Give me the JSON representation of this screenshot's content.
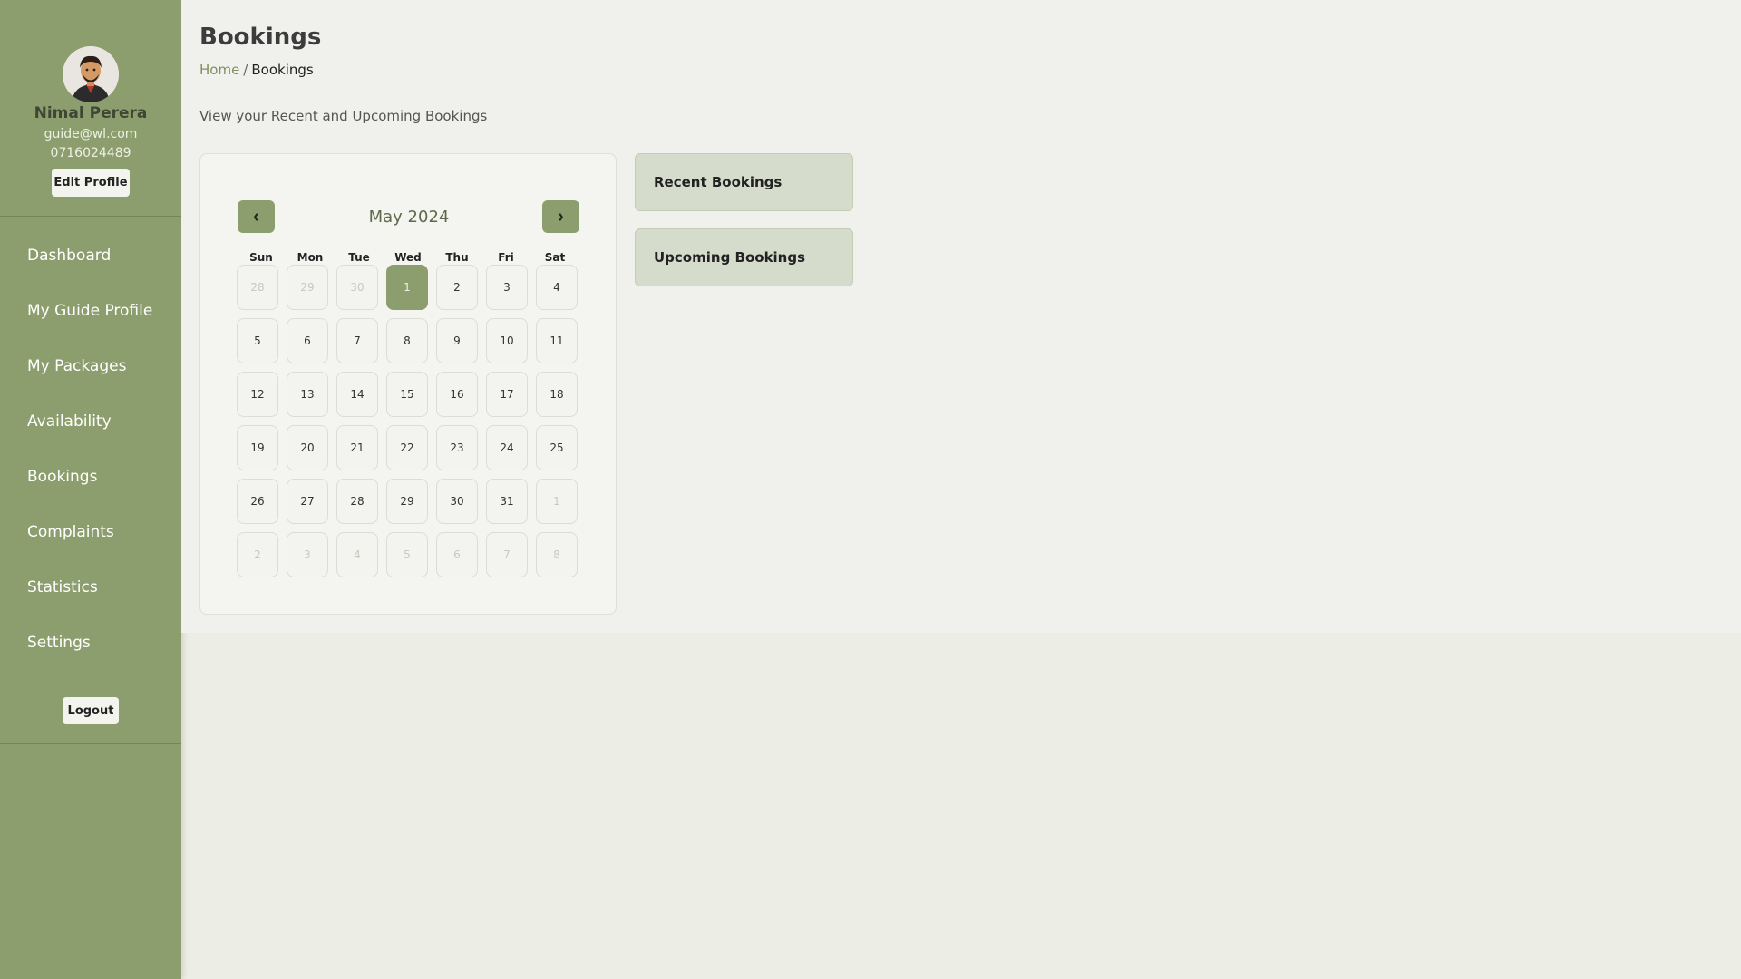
{
  "sidebar": {
    "profile": {
      "name": "Nimal Perera",
      "email": "guide@wl.com",
      "phone": "0716024489",
      "edit_label": "Edit Profile"
    },
    "items": [
      {
        "label": "Dashboard"
      },
      {
        "label": "My Guide Profile"
      },
      {
        "label": "My Packages"
      },
      {
        "label": "Availability"
      },
      {
        "label": "Bookings"
      },
      {
        "label": "Complaints"
      },
      {
        "label": "Statistics"
      },
      {
        "label": "Settings"
      }
    ],
    "logout_label": "Logout"
  },
  "header": {
    "title": "Bookings",
    "breadcrumb": {
      "home": "Home",
      "separator": "/",
      "current": "Bookings"
    },
    "subtitle": "View your Recent and Upcoming Bookings"
  },
  "calendar": {
    "month_label": "May 2024",
    "prev_icon": "‹",
    "next_icon": "›",
    "weekdays": [
      "Sun",
      "Mon",
      "Tue",
      "Wed",
      "Thu",
      "Fri",
      "Sat"
    ],
    "days": [
      "28",
      "29",
      "30",
      "1",
      "2",
      "3",
      "4",
      "5",
      "6",
      "7",
      "8",
      "9",
      "10",
      "11",
      "12",
      "13",
      "14",
      "15",
      "16",
      "17",
      "18",
      "19",
      "20",
      "21",
      "22",
      "23",
      "24",
      "25",
      "26",
      "27",
      "28",
      "29",
      "30",
      "31",
      "1",
      "2",
      "3",
      "4",
      "5",
      "6",
      "7",
      "8"
    ]
  },
  "cards": {
    "recent": "Recent Bookings",
    "upcoming": "Upcoming Bookings"
  },
  "colors": {
    "sidebar": "#8c9e6d",
    "accent": "#8c9e6d",
    "card": "#d6dccb",
    "background": "#f0f0ec"
  }
}
